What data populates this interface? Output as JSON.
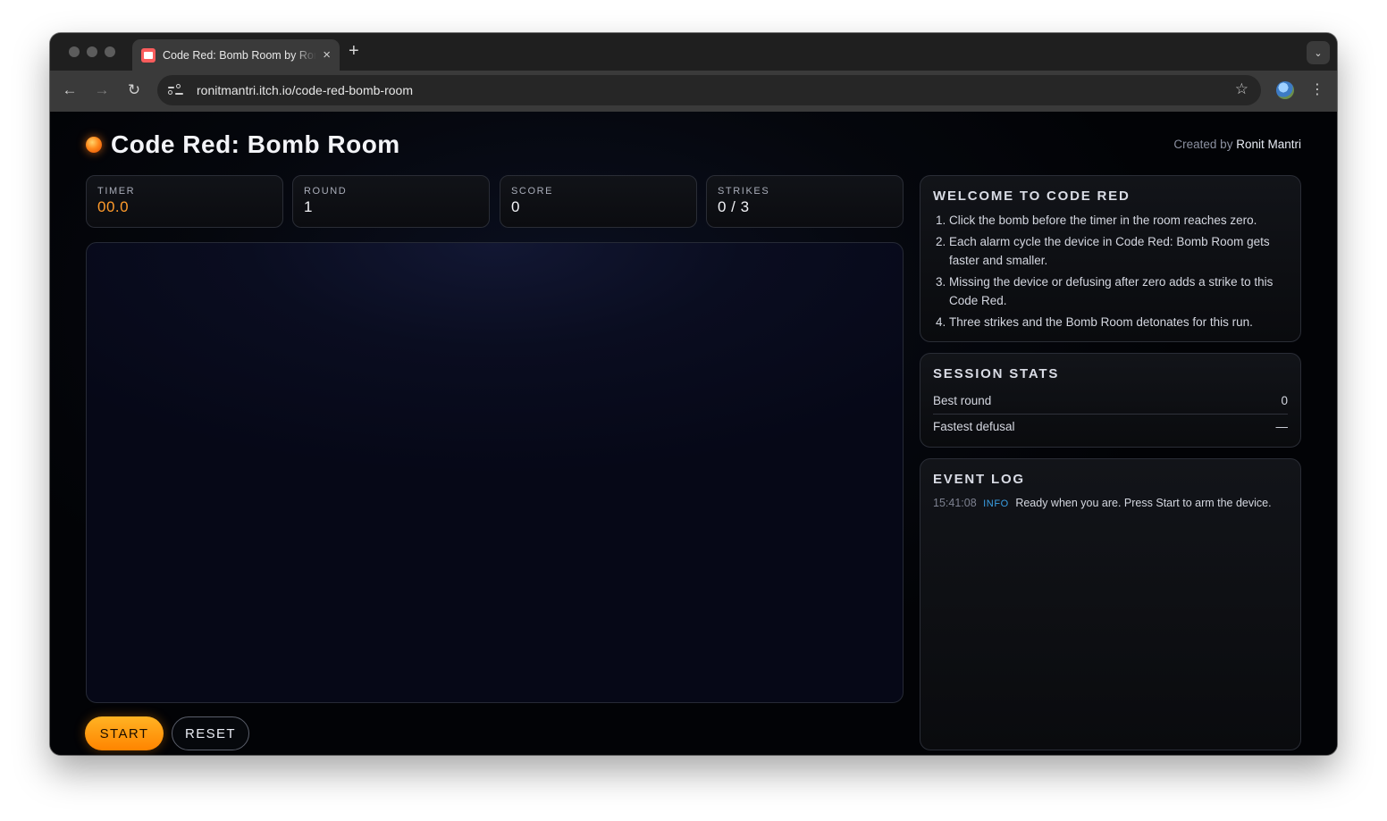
{
  "browser": {
    "tab_title": "Code Red: Bomb Room by Ronit Mantri",
    "tab_close": "×",
    "new_tab": "+",
    "tab_menu": "⌄",
    "back": "←",
    "forward": "→",
    "reload": "↻",
    "url": "ronitmantri.itch.io/code-red-bomb-room",
    "bookmark": "☆",
    "menu": "⋮"
  },
  "header": {
    "title": "Code Red: Bomb Room",
    "credit_prefix": "Created by",
    "credit_author": "Ronit Mantri"
  },
  "stats": [
    {
      "label": "TIMER",
      "value": "00.0"
    },
    {
      "label": "ROUND",
      "value": "1"
    },
    {
      "label": "SCORE",
      "value": "0"
    },
    {
      "label": "STRIKES",
      "value": "0 / 3"
    }
  ],
  "controls": {
    "start": "START",
    "reset": "RESET"
  },
  "welcome": {
    "title": "WELCOME TO CODE RED",
    "rules": [
      "Click the bomb before the timer in the room reaches zero.",
      "Each alarm cycle the device in Code Red: Bomb Room gets faster and smaller.",
      "Missing the device or defusing after zero adds a strike to this Code Red.",
      "Three strikes and the Bomb Room detonates for this run."
    ]
  },
  "session": {
    "title": "SESSION STATS",
    "rows": [
      {
        "label": "Best round",
        "value": "0"
      },
      {
        "label": "Fastest defusal",
        "value": "—"
      }
    ]
  },
  "log": {
    "title": "EVENT LOG",
    "entries": [
      {
        "time": "15:41:08",
        "level": "INFO",
        "message": "Ready when you are. Press Start to arm the device."
      }
    ]
  },
  "colors": {
    "accent": "#ff8c00",
    "timer": "#ff9b2b",
    "info": "#3aa0e6"
  }
}
